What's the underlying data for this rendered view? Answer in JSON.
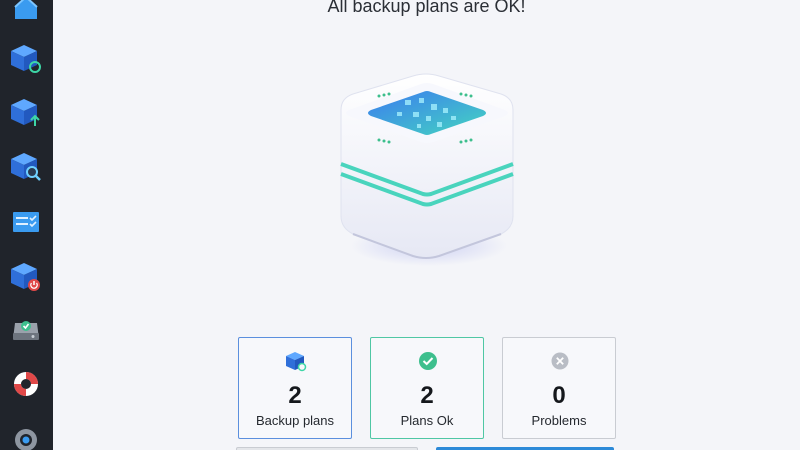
{
  "sidebar": {
    "items": [
      {
        "name": "home-icon"
      },
      {
        "name": "backup-restore-icon"
      },
      {
        "name": "backup-upload-icon"
      },
      {
        "name": "backup-search-icon"
      },
      {
        "name": "task-list-icon"
      },
      {
        "name": "backup-power-icon"
      },
      {
        "name": "drive-ok-icon"
      },
      {
        "name": "lifebuoy-icon"
      },
      {
        "name": "settings-icon"
      }
    ]
  },
  "main": {
    "headline": "All backup plans are OK!"
  },
  "stats": {
    "backup_plans": {
      "value": "2",
      "label": "Backup plans",
      "icon": "backup-cube-icon"
    },
    "plans_ok": {
      "value": "2",
      "label": "Plans Ok",
      "icon": "check-circle-icon"
    },
    "problems": {
      "value": "0",
      "label": "Problems",
      "icon": "x-circle-icon"
    }
  },
  "colors": {
    "sidebar_bg": "#20242b",
    "accent_blue": "#2d8ad8",
    "ok_green": "#3dbf8d",
    "teal": "#45d1b8"
  }
}
